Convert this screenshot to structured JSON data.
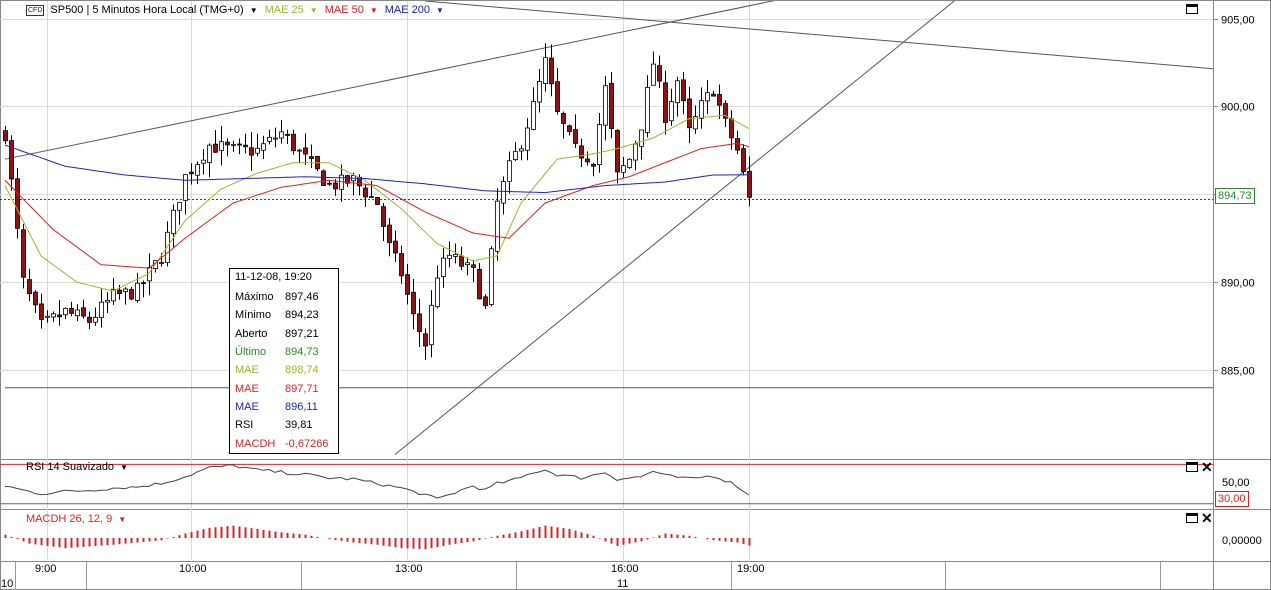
{
  "header": {
    "instrument_badge": "CFD",
    "instrument": "SP500 | 5 Minutos Hora Local (TMG+0)",
    "indicators": [
      {
        "label": "MAE 25",
        "color": "#9ab632"
      },
      {
        "label": "MAE 50",
        "color": "#e02020"
      },
      {
        "label": "MAE 200",
        "color": "#2020c0"
      }
    ]
  },
  "rsi_panel": {
    "label": "RSI 14 Suavizado",
    "level_label": "50,00",
    "low_label": "30,00"
  },
  "macd_panel": {
    "label": "MACDH 26, 12, 9",
    "level_label": "0,00000"
  },
  "last_price_label": "894,73",
  "tooltip": {
    "datetime": "11-12-08, 19:20",
    "rows": [
      {
        "label": "Máximo",
        "value": "897,46",
        "color": "#000000"
      },
      {
        "label": "Mínimo",
        "value": "894,23",
        "color": "#000000"
      },
      {
        "label": "Aberto",
        "value": "897,21",
        "color": "#000000"
      },
      {
        "label": "Último",
        "value": "894,73",
        "color": "#2c8a2c"
      },
      {
        "label": "MAE",
        "value": "898,74",
        "color": "#9ab632"
      },
      {
        "label": "MAE",
        "value": "897,71",
        "color": "#e02020"
      },
      {
        "label": "MAE",
        "value": "896,11",
        "color": "#2020c0"
      },
      {
        "label": "RSI",
        "value": "39,81",
        "color": "#000000"
      },
      {
        "label": "MACDH",
        "value": "-0,67266",
        "color": "#e02020"
      }
    ]
  },
  "chart_data": {
    "type": "line",
    "candle_count": 120,
    "y_range": [
      880,
      906
    ],
    "y_ticks": [
      {
        "value": 905,
        "label": "905,00"
      },
      {
        "value": 900,
        "label": "900,00"
      },
      {
        "value": 895,
        "label": "895,00"
      },
      {
        "value": 890,
        "label": "890,00"
      },
      {
        "value": 885,
        "label": "885,00"
      }
    ],
    "x_ticks": [
      {
        "index": 7,
        "label": "9:00"
      },
      {
        "index": 31,
        "label": "10:00"
      },
      {
        "index": 67,
        "label": "13:00"
      },
      {
        "index": 103,
        "label": "16:00"
      },
      {
        "index": 124,
        "label": "19:00"
      }
    ],
    "date_labels": [
      {
        "index": 0,
        "label": "10"
      },
      {
        "index": 102,
        "label": "11"
      }
    ],
    "close_anchors": [
      [
        0,
        898.5
      ],
      [
        3,
        890
      ],
      [
        6,
        887.5
      ],
      [
        10,
        888.3
      ],
      [
        14,
        887.8
      ],
      [
        18,
        889.2
      ],
      [
        22,
        889.5
      ],
      [
        26,
        891.5
      ],
      [
        30,
        896
      ],
      [
        34,
        897.8
      ],
      [
        38,
        897.5
      ],
      [
        42,
        897.5
      ],
      [
        46,
        898.5
      ],
      [
        50,
        897
      ],
      [
        54,
        895.5
      ],
      [
        58,
        895.8
      ],
      [
        62,
        894.5
      ],
      [
        64,
        892
      ],
      [
        66,
        890.5
      ],
      [
        68,
        888
      ],
      [
        70,
        886.5
      ],
      [
        72,
        890.5
      ],
      [
        74,
        891.5
      ],
      [
        76,
        891
      ],
      [
        78,
        890.5
      ],
      [
        80,
        888.5
      ],
      [
        82,
        894.5
      ],
      [
        84,
        896.5
      ],
      [
        86,
        898
      ],
      [
        88,
        900
      ],
      [
        90,
        902.5
      ],
      [
        92,
        899.5
      ],
      [
        95,
        897.5
      ],
      [
        98,
        897
      ],
      [
        100,
        901
      ],
      [
        102,
        896
      ],
      [
        104,
        897
      ],
      [
        106,
        899
      ],
      [
        108,
        902.5
      ],
      [
        110,
        899.5
      ],
      [
        112,
        901.5
      ],
      [
        114,
        898.5
      ],
      [
        116,
        900
      ],
      [
        118,
        901
      ],
      [
        120,
        899
      ],
      [
        122,
        897.5
      ],
      [
        124,
        894.73
      ]
    ],
    "sma25": [
      [
        0,
        895.5
      ],
      [
        6,
        891.5
      ],
      [
        12,
        890
      ],
      [
        18,
        889.5
      ],
      [
        24,
        890.5
      ],
      [
        30,
        893.5
      ],
      [
        36,
        895.3
      ],
      [
        42,
        896.2
      ],
      [
        48,
        896.8
      ],
      [
        54,
        896.8
      ],
      [
        60,
        895.8
      ],
      [
        66,
        894.2
      ],
      [
        72,
        892.2
      ],
      [
        78,
        891.2
      ],
      [
        82,
        891.5
      ],
      [
        86,
        894.5
      ],
      [
        92,
        897
      ],
      [
        98,
        897.3
      ],
      [
        102,
        897.6
      ],
      [
        108,
        898.2
      ],
      [
        114,
        899.3
      ],
      [
        120,
        899.5
      ],
      [
        124,
        898.74
      ]
    ],
    "sma50": [
      [
        0,
        895.8
      ],
      [
        8,
        893
      ],
      [
        16,
        891
      ],
      [
        24,
        890.8
      ],
      [
        30,
        892.5
      ],
      [
        38,
        894.5
      ],
      [
        46,
        895.4
      ],
      [
        54,
        895.8
      ],
      [
        62,
        895.5
      ],
      [
        70,
        894
      ],
      [
        78,
        892.8
      ],
      [
        84,
        892.5
      ],
      [
        90,
        894.5
      ],
      [
        98,
        895.5
      ],
      [
        104,
        896
      ],
      [
        110,
        896.8
      ],
      [
        116,
        897.6
      ],
      [
        122,
        897.9
      ],
      [
        124,
        897.71
      ]
    ],
    "sma200": [
      [
        0,
        897.8
      ],
      [
        10,
        896.6
      ],
      [
        20,
        896.1
      ],
      [
        30,
        895.8
      ],
      [
        40,
        895.9
      ],
      [
        50,
        896
      ],
      [
        60,
        895.9
      ],
      [
        70,
        895.6
      ],
      [
        80,
        895.2
      ],
      [
        90,
        895.1
      ],
      [
        100,
        895.5
      ],
      [
        110,
        895.7
      ],
      [
        118,
        896.1
      ],
      [
        124,
        896.11
      ]
    ],
    "trendlines": [
      {
        "from": [
          0,
          897
        ],
        "to": [
          135,
          906.5
        ]
      },
      {
        "from": [
          70,
          906
        ],
        "to": [
          230,
          901.3
        ]
      },
      {
        "from": [
          65,
          880.2
        ],
        "to": [
          160,
          906.5
        ]
      },
      {
        "from": [
          0,
          884.0
        ],
        "to": [
          230,
          884.0
        ]
      }
    ],
    "rsi": {
      "range": [
        30,
        70
      ],
      "levels": [
        67,
        32
      ],
      "anchors": [
        [
          0,
          48
        ],
        [
          3,
          44
        ],
        [
          6,
          41
        ],
        [
          10,
          43
        ],
        [
          14,
          44
        ],
        [
          18,
          46
        ],
        [
          22,
          47
        ],
        [
          26,
          50
        ],
        [
          30,
          56
        ],
        [
          34,
          64
        ],
        [
          38,
          66
        ],
        [
          42,
          62
        ],
        [
          46,
          60
        ],
        [
          50,
          58
        ],
        [
          54,
          55
        ],
        [
          58,
          54
        ],
        [
          62,
          50
        ],
        [
          66,
          46
        ],
        [
          70,
          40
        ],
        [
          72,
          36
        ],
        [
          74,
          40
        ],
        [
          76,
          44
        ],
        [
          78,
          48
        ],
        [
          80,
          44
        ],
        [
          82,
          50
        ],
        [
          84,
          52
        ],
        [
          86,
          55
        ],
        [
          88,
          60
        ],
        [
          90,
          62
        ],
        [
          92,
          58
        ],
        [
          96,
          55
        ],
        [
          100,
          60
        ],
        [
          102,
          54
        ],
        [
          106,
          56
        ],
        [
          108,
          61
        ],
        [
          110,
          57
        ],
        [
          114,
          54
        ],
        [
          118,
          57
        ],
        [
          120,
          53
        ],
        [
          122,
          48
        ],
        [
          124,
          39.81
        ]
      ]
    },
    "macdh": {
      "range": [
        -1.6,
        1.6
      ],
      "anchors": [
        [
          0,
          0.3
        ],
        [
          4,
          -0.5
        ],
        [
          10,
          -0.9
        ],
        [
          18,
          -0.6
        ],
        [
          26,
          -0.2
        ],
        [
          30,
          0.4
        ],
        [
          34,
          0.9
        ],
        [
          38,
          1.1
        ],
        [
          42,
          0.8
        ],
        [
          46,
          0.5
        ],
        [
          50,
          0.3
        ],
        [
          54,
          -0.1
        ],
        [
          58,
          -0.4
        ],
        [
          62,
          -0.6
        ],
        [
          66,
          -0.9
        ],
        [
          70,
          -1.0
        ],
        [
          74,
          -0.6
        ],
        [
          78,
          -0.3
        ],
        [
          82,
          0.2
        ],
        [
          86,
          0.6
        ],
        [
          90,
          1.1
        ],
        [
          94,
          0.8
        ],
        [
          98,
          0.2
        ],
        [
          100,
          -0.3
        ],
        [
          102,
          -0.7
        ],
        [
          106,
          -0.3
        ],
        [
          110,
          0.4
        ],
        [
          114,
          0.2
        ],
        [
          118,
          -0.2
        ],
        [
          122,
          -0.4
        ],
        [
          124,
          -0.67
        ]
      ]
    },
    "last_price": 894.73
  }
}
